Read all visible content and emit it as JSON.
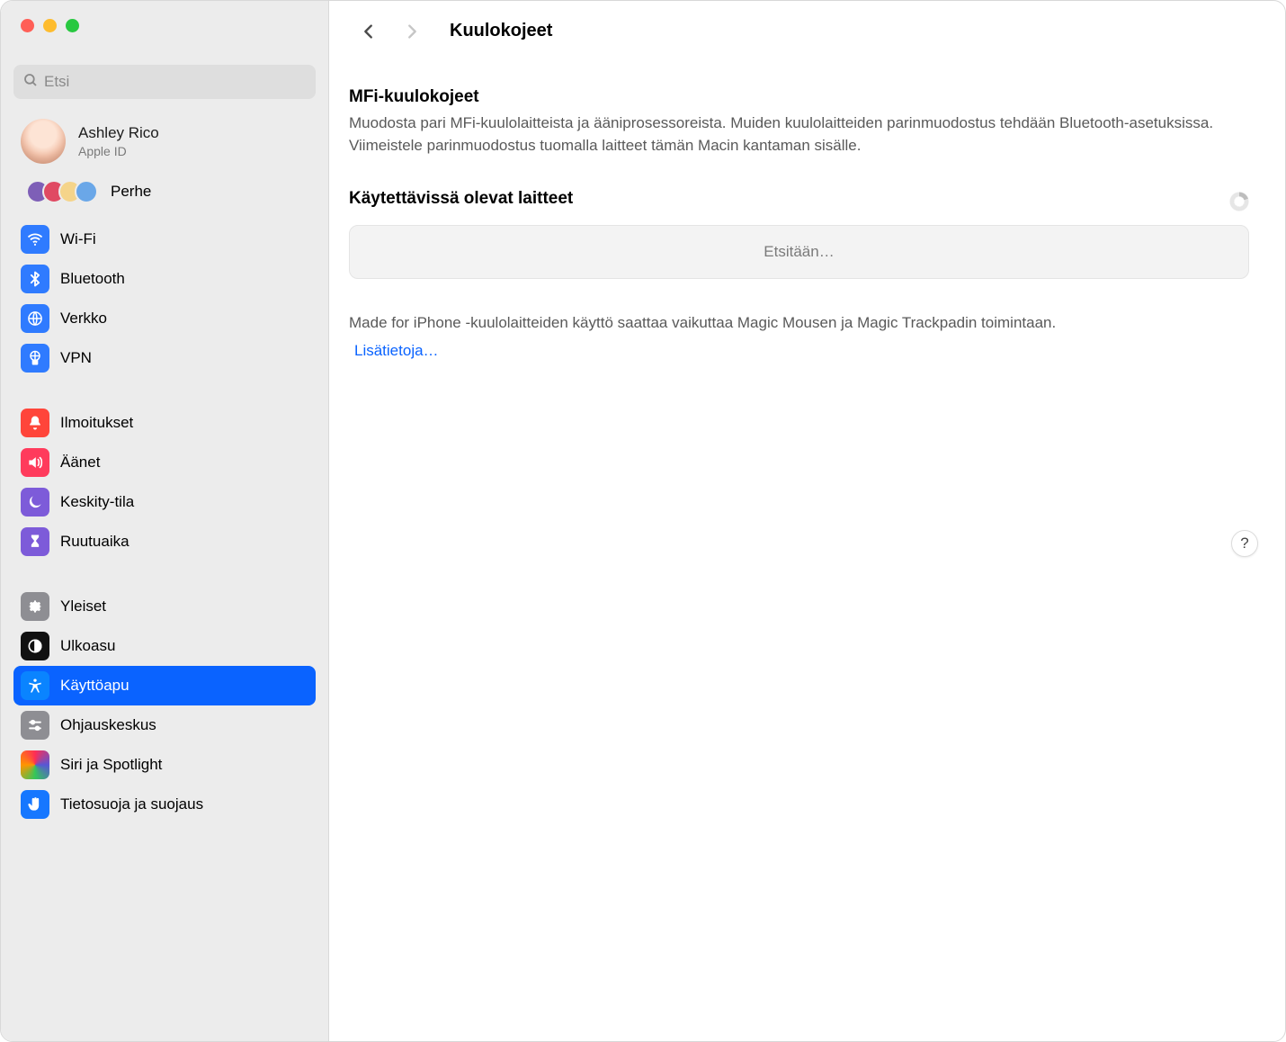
{
  "search": {
    "placeholder": "Etsi"
  },
  "account": {
    "name": "Ashley Rico",
    "sub": "Apple ID"
  },
  "family": {
    "label": "Perhe"
  },
  "sidebar": {
    "group1": [
      {
        "label": "Wi-Fi"
      },
      {
        "label": "Bluetooth"
      },
      {
        "label": "Verkko"
      },
      {
        "label": "VPN"
      }
    ],
    "group2": [
      {
        "label": "Ilmoitukset"
      },
      {
        "label": "Äänet"
      },
      {
        "label": "Keskity-tila"
      },
      {
        "label": "Ruutuaika"
      }
    ],
    "group3": [
      {
        "label": "Yleiset"
      },
      {
        "label": "Ulkoasu"
      },
      {
        "label": "Käyttöapu"
      },
      {
        "label": "Ohjauskeskus"
      },
      {
        "label": "Siri ja Spotlight"
      },
      {
        "label": "Tietosuoja ja suojaus"
      }
    ]
  },
  "header": {
    "title": "Kuulokojeet"
  },
  "mfi": {
    "heading": "MFi-kuulokojeet",
    "desc": "Muodosta pari MFi-kuulolaitteista ja ääniprosessoreista. Muiden kuulolaitteiden parinmuodostus tehdään Bluetooth-asetuksissa. Viimeistele parinmuodostus tuomalla laitteet tämän Macin kantaman sisälle."
  },
  "avail": {
    "heading": "Käytettävissä olevat laitteet",
    "searching": "Etsitään…"
  },
  "note": "Made for iPhone -kuulolaitteiden käyttö saattaa vaikuttaa Magic Mousen ja Magic Trackpadin toimintaan.",
  "learn_more": "Lisätietoja…",
  "help": "?"
}
